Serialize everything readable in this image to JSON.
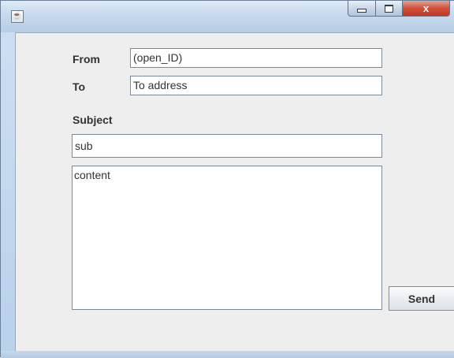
{
  "window": {
    "title": "",
    "close_glyph": "x",
    "icon_name": "java-cup-icon",
    "colors": {
      "frame": "#c6d9ee",
      "client": "#eeeeee",
      "close": "#c23a22"
    }
  },
  "form": {
    "from_label": "From",
    "from_value": "(open_ID)",
    "to_label": "To",
    "to_value": "To address",
    "subject_label": "Subject",
    "subject_value": "sub",
    "content_value": "content",
    "send_label": "Send"
  }
}
